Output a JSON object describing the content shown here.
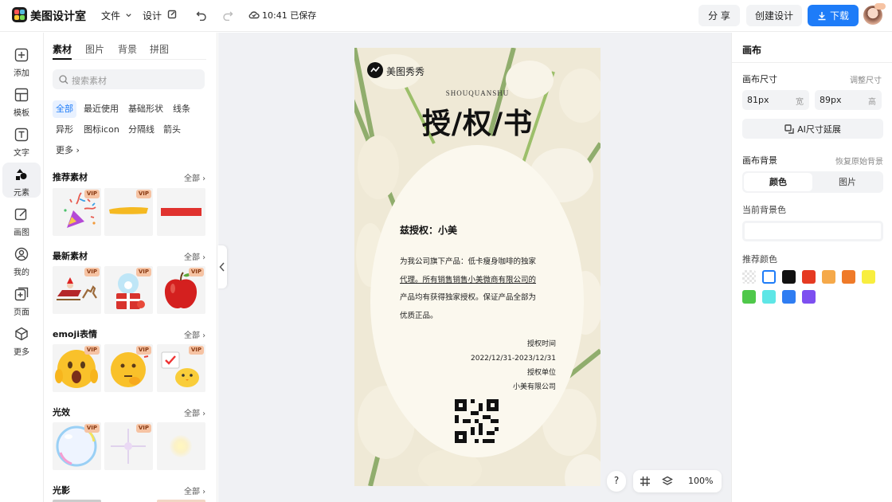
{
  "app": {
    "name": "美图设计室",
    "menu_file": "文件",
    "menu_design": "设计",
    "save_status": "10:41 已保存",
    "share": "分 享",
    "create_design": "创建设计",
    "download": "下载"
  },
  "leftnav": {
    "items": [
      {
        "label": "添加",
        "icon": "add-icon"
      },
      {
        "label": "模板",
        "icon": "template-icon"
      },
      {
        "label": "文字",
        "icon": "text-icon"
      },
      {
        "label": "元素",
        "icon": "element-icon"
      },
      {
        "label": "画图",
        "icon": "draw-icon"
      },
      {
        "label": "我的",
        "icon": "profile-icon"
      },
      {
        "label": "页面",
        "icon": "page-icon"
      },
      {
        "label": "更多",
        "icon": "more-icon"
      }
    ]
  },
  "panel": {
    "tabs": [
      "素材",
      "图片",
      "背景",
      "拼图"
    ],
    "search_placeholder": "搜索素材",
    "chips": [
      "全部",
      "最近使用",
      "基础形状",
      "线条",
      "异形",
      "图标icon",
      "分隔线",
      "箭头",
      "更多"
    ],
    "all_label": "全部",
    "vip": "VIP",
    "sections": [
      {
        "title": "推荐素材",
        "items": [
          "party-popper",
          "yellow-brush-stroke",
          "red-rectangle"
        ]
      },
      {
        "title": "最新素材",
        "items": [
          "santa-sleigh",
          "snow-globe-gift",
          "red-apple"
        ]
      },
      {
        "title": "emoji表情",
        "items": [
          "shocked-emoji",
          "thinking-emoji",
          "chick-emoji"
        ]
      },
      {
        "title": "光效",
        "items": [
          "rainbow-bubble",
          "sparkle-light",
          "soft-glow"
        ]
      },
      {
        "title": "光影",
        "items": []
      }
    ]
  },
  "poster": {
    "brand": "美图秀秀",
    "pinyin": "SHOUQUANSHU",
    "title": "授/权/书",
    "grantee": "兹授权：小美",
    "body_lines": [
      "为我公司旗下产品：低卡瘦身咖啡的独家",
      "代理。所有销售销售小美微商有限公司的",
      "产品均有获得独家授权。保证产品全部为",
      "优质正品。"
    ],
    "sign_lines": [
      "授权时间",
      "2022/12/31-2023/12/31",
      "授权单位",
      "小美有限公司"
    ]
  },
  "zoom": {
    "help": "?",
    "level": "100%"
  },
  "rightpanel": {
    "title": "画布",
    "size_label": "画布尺寸",
    "adjust": "调整尺寸",
    "width_value": "81px",
    "width_unit": "宽",
    "height_value": "89px",
    "height_unit": "高",
    "ai_extend": "AI尺寸延展",
    "bg_label": "画布背景",
    "restore": "恢复原始背景",
    "seg_color": "颜色",
    "seg_image": "图片",
    "current_bg": "当前背景色",
    "recommend": "推荐颜色",
    "colors": [
      "transparent",
      "#ffffff",
      "#111111",
      "#e53a22",
      "#f5a94a",
      "#ef7a29",
      "#f8ee3f",
      "#4fc84a",
      "#5ee6e6",
      "#2f7df2",
      "#7d4ff0"
    ]
  }
}
